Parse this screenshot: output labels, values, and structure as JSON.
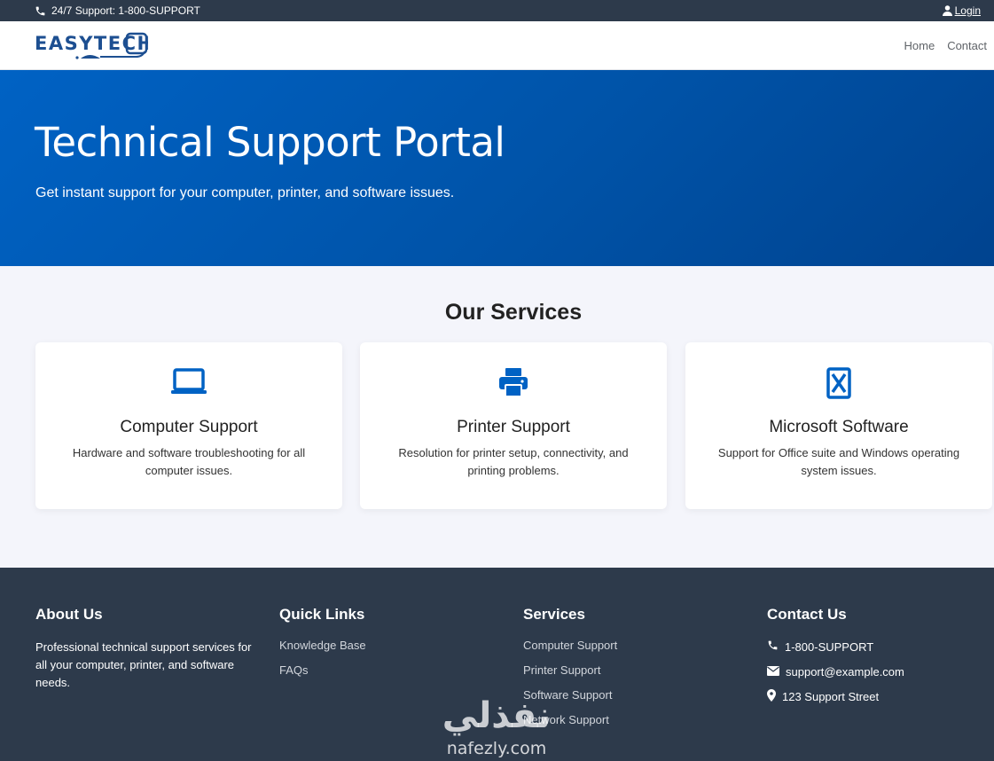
{
  "topbar": {
    "support_text": "24/7 Support: 1-800-SUPPORT",
    "login_label": "Login"
  },
  "brand": {
    "logo_text": "EASYTECH",
    "primary_color": "#0062c4",
    "dark_color": "#2d3a4b"
  },
  "nav": {
    "items": [
      {
        "label": "Home"
      },
      {
        "label": "Contact"
      }
    ]
  },
  "hero": {
    "title": "Technical Support Portal",
    "subtitle": "Get instant support for your computer, printer, and software issues."
  },
  "services": {
    "heading": "Our Services",
    "cards": [
      {
        "icon": "laptop-icon",
        "title": "Computer Support",
        "description": "Hardware and software troubleshooting for all computer issues."
      },
      {
        "icon": "printer-icon",
        "title": "Printer Support",
        "description": "Resolution for printer setup, connectivity, and printing problems."
      },
      {
        "icon": "microsoft-icon",
        "title": "Microsoft Software",
        "description": "Support for Office suite and Windows operating system issues."
      }
    ]
  },
  "footer": {
    "about": {
      "heading": "About Us",
      "text": "Professional technical support services for all your computer, printer, and software needs."
    },
    "quick_links": {
      "heading": "Quick Links",
      "items": [
        {
          "label": "Knowledge Base"
        },
        {
          "label": "FAQs"
        }
      ]
    },
    "services": {
      "heading": "Services",
      "items": [
        {
          "label": "Computer Support"
        },
        {
          "label": "Printer Support"
        },
        {
          "label": "Software Support"
        },
        {
          "label": "Network Support"
        }
      ]
    },
    "contact": {
      "heading": "Contact Us",
      "items": [
        {
          "icon": "phone-icon",
          "text": "1-800-SUPPORT"
        },
        {
          "icon": "envelope-icon",
          "text": "support@example.com"
        },
        {
          "icon": "map-marker-icon",
          "text": "123 Support Street"
        }
      ]
    }
  },
  "watermark": {
    "arabic_text": "نفذلي",
    "latin_text": "nafezly.com"
  }
}
